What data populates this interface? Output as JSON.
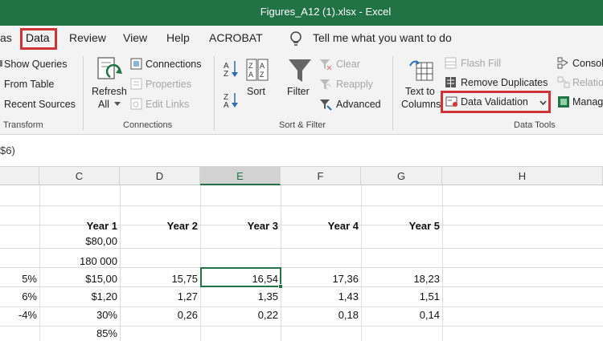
{
  "window": {
    "title": "Figures_A12 (1).xlsx  -  Excel"
  },
  "tabs": {
    "partial": "as",
    "data": "Data",
    "review": "Review",
    "view": "View",
    "help": "Help",
    "acrobat": "ACROBAT",
    "tellme": "Tell me what you want to do"
  },
  "ribbon": {
    "get_transform": {
      "show_queries": "Show Queries",
      "from_table": "From Table",
      "recent_sources": "Recent Sources",
      "label": "Transform"
    },
    "connections": {
      "refresh_all_line1": "Refresh",
      "refresh_all_line2": "All",
      "connections": "Connections",
      "properties": "Properties",
      "edit_links": "Edit Links",
      "label": "Connections"
    },
    "sort_filter": {
      "sort": "Sort",
      "filter": "Filter",
      "clear": "Clear",
      "reapply": "Reapply",
      "advanced": "Advanced",
      "label": "Sort & Filter"
    },
    "data_tools": {
      "text_to_columns_line1": "Text to",
      "text_to_columns_line2": "Columns",
      "flash_fill": "Flash Fill",
      "remove_duplicates": "Remove Duplicates",
      "data_validation": "Data Validation",
      "consolidate": "Consol",
      "relationships": "Relatio",
      "manage": "Manag",
      "label": "Data Tools"
    }
  },
  "formula_bar": {
    "text": "$6)"
  },
  "columns": [
    "C",
    "D",
    "E",
    "F",
    "G",
    "H"
  ],
  "rows": [
    {
      "b": "",
      "c": "",
      "d": "",
      "e": "",
      "f": "",
      "g": ""
    },
    {
      "b": "",
      "c": "",
      "d": "",
      "e": "",
      "f": "",
      "g": ""
    },
    {
      "b": "",
      "c": "Year 1",
      "d": "Year 2",
      "e": "Year 3",
      "f": "Year 4",
      "g": "Year 5"
    },
    {
      "b": "",
      "c": "$80,00",
      "d": "",
      "e": "",
      "f": "",
      "g": ""
    },
    {
      "b": "",
      "c": "180 000",
      "d": "",
      "e": "",
      "f": "",
      "g": ""
    },
    {
      "b": "5%",
      "c": "$15,00",
      "d": "15,75",
      "e": "16,54",
      "f": "17,36",
      "g": "18,23"
    },
    {
      "b": "6%",
      "c": "$1,20",
      "d": "1,27",
      "e": "1,35",
      "f": "1,43",
      "g": "1,51"
    },
    {
      "b": "-4%",
      "c": "30%",
      "d": "0,26",
      "e": "0,22",
      "f": "0,18",
      "g": "0,14"
    },
    {
      "b": "",
      "c": "85%",
      "d": "",
      "e": "",
      "f": "",
      "g": ""
    }
  ],
  "colors": {
    "excel_green": "#217346",
    "highlight_red": "#d13438"
  }
}
